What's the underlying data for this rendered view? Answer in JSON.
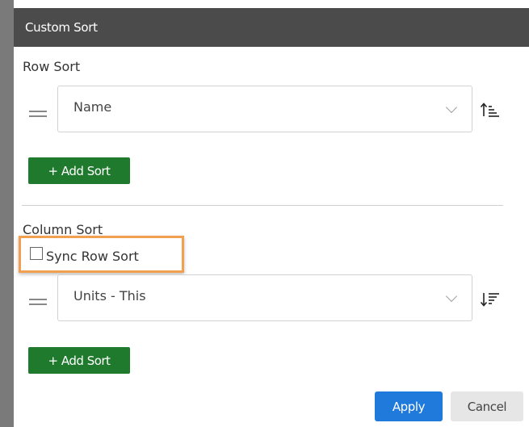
{
  "dialog": {
    "title": "Custom Sort"
  },
  "row_sort": {
    "title": "Row Sort",
    "selected_field": "Name",
    "direction_icon": "sort-ascending-icon",
    "add_sort_label": "+ Add Sort"
  },
  "column_sort": {
    "title": "Column Sort",
    "sync_label": "Sync Row Sort",
    "sync_checked": false,
    "selected_field": "Units - This",
    "direction_icon": "sort-descending-icon",
    "add_sort_label": "+ Add Sort"
  },
  "footer": {
    "apply_label": "Apply",
    "cancel_label": "Cancel"
  },
  "colors": {
    "titlebar": "#4b4b4b",
    "add_button": "#1f7a2e",
    "apply_button": "#1f7adb",
    "cancel_button": "#e6e6e6",
    "highlight": "#f0a050"
  }
}
